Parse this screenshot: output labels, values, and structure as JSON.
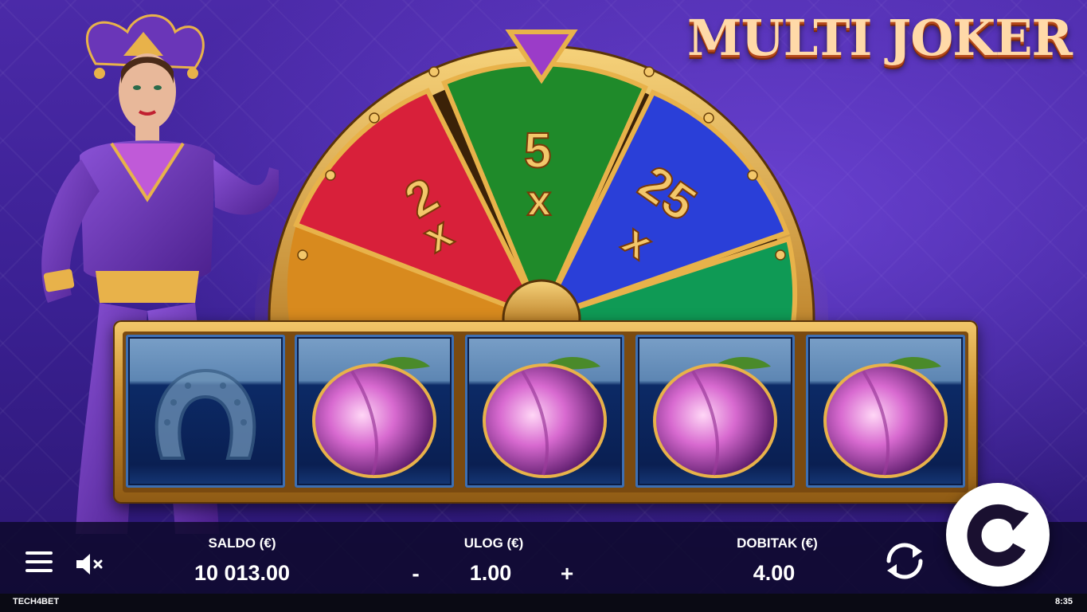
{
  "game": {
    "title": "MULTI JOKER",
    "brand": "TECH4BET",
    "clock": "8:35"
  },
  "wheel": {
    "segments": [
      {
        "label_top": "2",
        "label_bottom": "x",
        "color": "#d8203a"
      },
      {
        "label_top": "5",
        "label_bottom": "x",
        "color": "#1f8a2a"
      },
      {
        "label_top": "25",
        "label_bottom": "x",
        "color": "#2a3fd8"
      }
    ],
    "partial_segments": [
      {
        "color": "#d88a1e"
      },
      {
        "color": "#0f9a55"
      }
    ]
  },
  "reels": {
    "symbols": [
      "horseshoe",
      "plum",
      "plum",
      "plum",
      "plum"
    ]
  },
  "bar": {
    "balance_label": "SALDO (€)",
    "balance_value": "10 013.00",
    "bet_label": "ULOG (€)",
    "bet_value": "1.00",
    "bet_minus": "-",
    "bet_plus": "+",
    "win_label": "DOBITAK (€)",
    "win_value": "4.00"
  },
  "icons": {
    "menu": "hamburger-menu-icon",
    "sound": "sound-muted-icon",
    "autoplay": "autoplay-icon",
    "spin": "spin-icon"
  },
  "colors": {
    "gold": "#e8b24a",
    "bar_bg": "#0c0828",
    "background": "#3a2092"
  }
}
